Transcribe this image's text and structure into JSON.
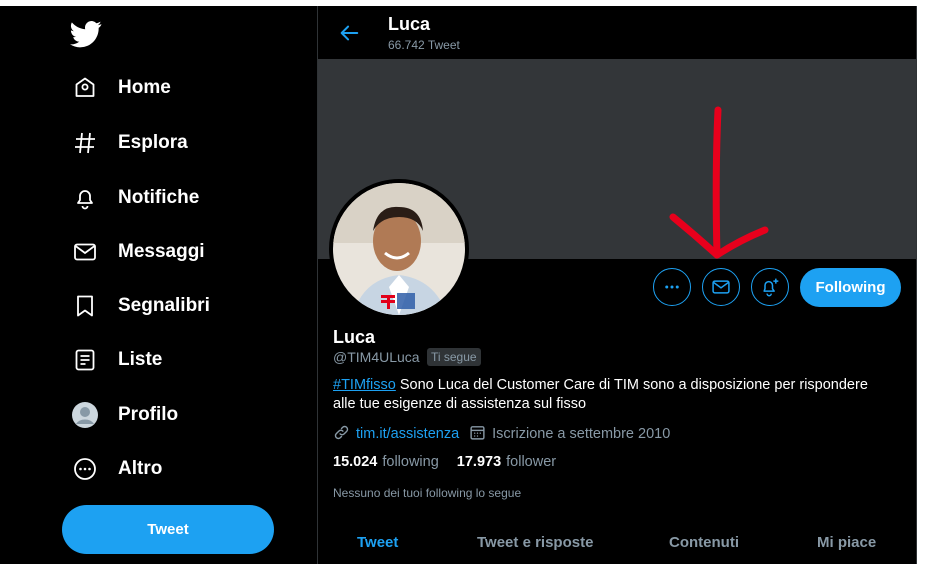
{
  "sidebar": {
    "logo_icon": "twitter-bird-icon",
    "items": [
      {
        "label": "Home",
        "icon": "home-icon"
      },
      {
        "label": "Esplora",
        "icon": "hashtag-icon"
      },
      {
        "label": "Notifiche",
        "icon": "bell-icon"
      },
      {
        "label": "Messaggi",
        "icon": "mail-icon"
      },
      {
        "label": "Segnalibri",
        "icon": "bookmark-icon"
      },
      {
        "label": "Liste",
        "icon": "list-icon"
      },
      {
        "label": "Profilo",
        "icon": "avatar-icon"
      },
      {
        "label": "Altro",
        "icon": "more-icon"
      }
    ],
    "tweet_button": "Tweet"
  },
  "header": {
    "name": "Luca",
    "tweet_count": "66.742 Tweet"
  },
  "profile": {
    "name": "Luca",
    "handle": "@TIM4ULuca",
    "follows_you": "Ti segue",
    "bio_hashtag": "#TIMfisso",
    "bio_line1": " Sono Luca del Customer Care di TIM sono a disposizione per rispondere",
    "bio_line2": "alle tue esigenze di assistenza sul fisso",
    "link": "tim.it/assistenza",
    "joined": "Iscrizione a settembre 2010",
    "following_count": "15.024",
    "following_label": "following",
    "followers_count": "17.973",
    "followers_label": "follower",
    "no_mutual": "Nessuno dei tuoi following lo segue",
    "follow_button": "Following"
  },
  "tabs": [
    "Tweet",
    "Tweet e risposte",
    "Contenuti",
    "Mi piace"
  ],
  "colors": {
    "accent": "#1da1f2",
    "muted": "#8899a6",
    "banner": "#333639",
    "annotation": "#e8001c"
  }
}
